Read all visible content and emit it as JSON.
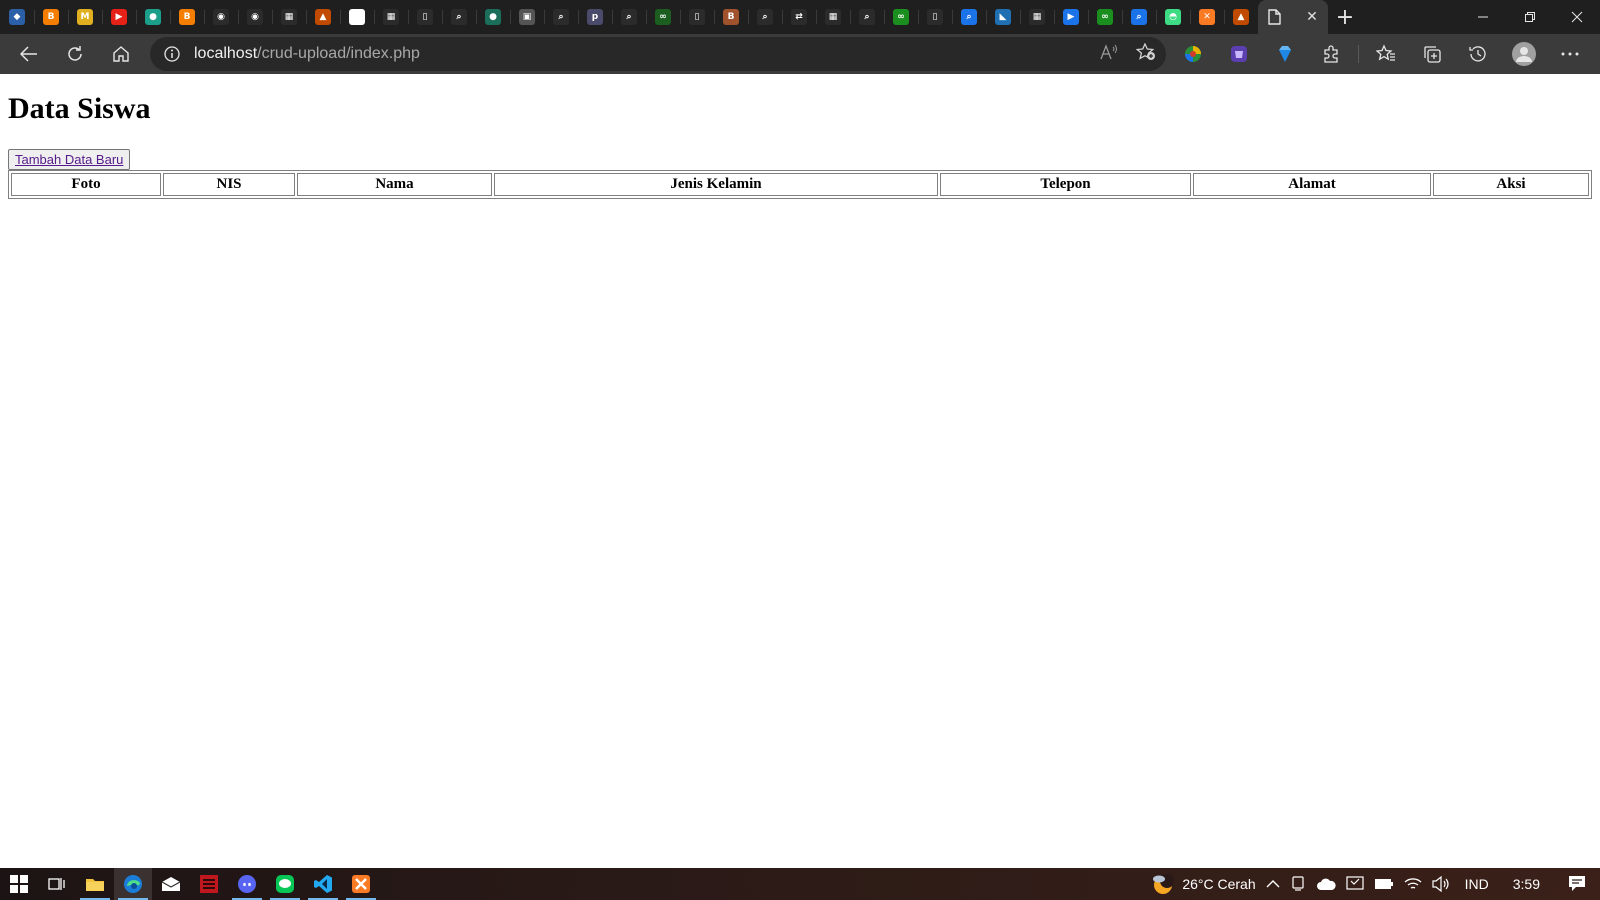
{
  "browser": {
    "tabs": [
      {
        "icon": "gem-icon",
        "color": "#2b5fa8",
        "glyph": "◆"
      },
      {
        "icon": "blogger-icon",
        "color": "#f57d00",
        "glyph": "B"
      },
      {
        "icon": "mp-icon",
        "color": "#e0b020",
        "glyph": "M"
      },
      {
        "icon": "youtube-icon",
        "color": "#e62117",
        "glyph": "▶"
      },
      {
        "icon": "circle-app-icon",
        "color": "#1b9e8a",
        "glyph": "●"
      },
      {
        "icon": "blogger-icon",
        "color": "#f57d00",
        "glyph": "B"
      },
      {
        "icon": "github-icon",
        "color": "#2b2b2b",
        "glyph": "◉"
      },
      {
        "icon": "github-icon",
        "color": "#2b2b2b",
        "glyph": "◉"
      },
      {
        "icon": "calendar-icon",
        "color": "#2b2b2b",
        "glyph": "▦"
      },
      {
        "icon": "warning-logo-icon",
        "color": "#c04a00",
        "glyph": "▲"
      },
      {
        "icon": "github-icon",
        "color": "#ffffff",
        "glyph": "◉"
      },
      {
        "icon": "calendar-icon",
        "color": "#2b2b2b",
        "glyph": "▦"
      },
      {
        "icon": "page-icon",
        "color": "#2b2b2b",
        "glyph": "▯"
      },
      {
        "icon": "search-icon",
        "color": "#2b2b2b",
        "glyph": "⌕"
      },
      {
        "icon": "circle-app-icon",
        "color": "#1b6e5a",
        "glyph": "●"
      },
      {
        "icon": "image-icon",
        "color": "#555555",
        "glyph": "▣"
      },
      {
        "icon": "search-icon",
        "color": "#2b2b2b",
        "glyph": "⌕"
      },
      {
        "icon": "php-icon",
        "color": "#4a4a6a",
        "glyph": "p"
      },
      {
        "icon": "search-icon",
        "color": "#2b2b2b",
        "glyph": "⌕"
      },
      {
        "icon": "link-icon",
        "color": "#1b5e20",
        "glyph": "∞"
      },
      {
        "icon": "page-icon",
        "color": "#2b2b2b",
        "glyph": "▯"
      },
      {
        "icon": "blogger-icon",
        "color": "#a0522d",
        "glyph": "B"
      },
      {
        "icon": "search-icon",
        "color": "#2b2b2b",
        "glyph": "⌕"
      },
      {
        "icon": "arrows-icon",
        "color": "#2b2b2b",
        "glyph": "⇄"
      },
      {
        "icon": "calendar-icon",
        "color": "#2b2b2b",
        "glyph": "▦"
      },
      {
        "icon": "search-icon",
        "color": "#2b2b2b",
        "glyph": "⌕"
      },
      {
        "icon": "link-icon",
        "color": "#1b8e20",
        "glyph": "∞"
      },
      {
        "icon": "page-icon",
        "color": "#2b2b2b",
        "glyph": "▯"
      },
      {
        "icon": "search-icon",
        "color": "#1a73e8",
        "glyph": "⌕"
      },
      {
        "icon": "chart-icon",
        "color": "#1f6fb2",
        "glyph": "◣"
      },
      {
        "icon": "calendar-icon",
        "color": "#2b2b2b",
        "glyph": "▦"
      },
      {
        "icon": "play-icon",
        "color": "#1a73e8",
        "glyph": "▶"
      },
      {
        "icon": "link-icon",
        "color": "#1b8e20",
        "glyph": "∞"
      },
      {
        "icon": "search-icon",
        "color": "#1a73e8",
        "glyph": "⌕"
      },
      {
        "icon": "android-icon",
        "color": "#3ddc84",
        "glyph": "◓"
      },
      {
        "icon": "xampp-icon",
        "color": "#fb7a24",
        "glyph": "✕"
      },
      {
        "icon": "warning-logo-icon",
        "color": "#c04a00",
        "glyph": "▲"
      }
    ],
    "address": {
      "host": "localhost",
      "path": "/crud-upload/index.php"
    }
  },
  "page": {
    "title": "Data Siswa",
    "add_button_label": "Tambah Data Baru",
    "table_headers": [
      "Foto",
      "NIS",
      "Nama",
      "Jenis Kelamin",
      "Telepon",
      "Alamat",
      "Aksi"
    ]
  },
  "taskbar": {
    "weather": "26°C  Cerah",
    "language": "IND",
    "time": "3:59"
  }
}
